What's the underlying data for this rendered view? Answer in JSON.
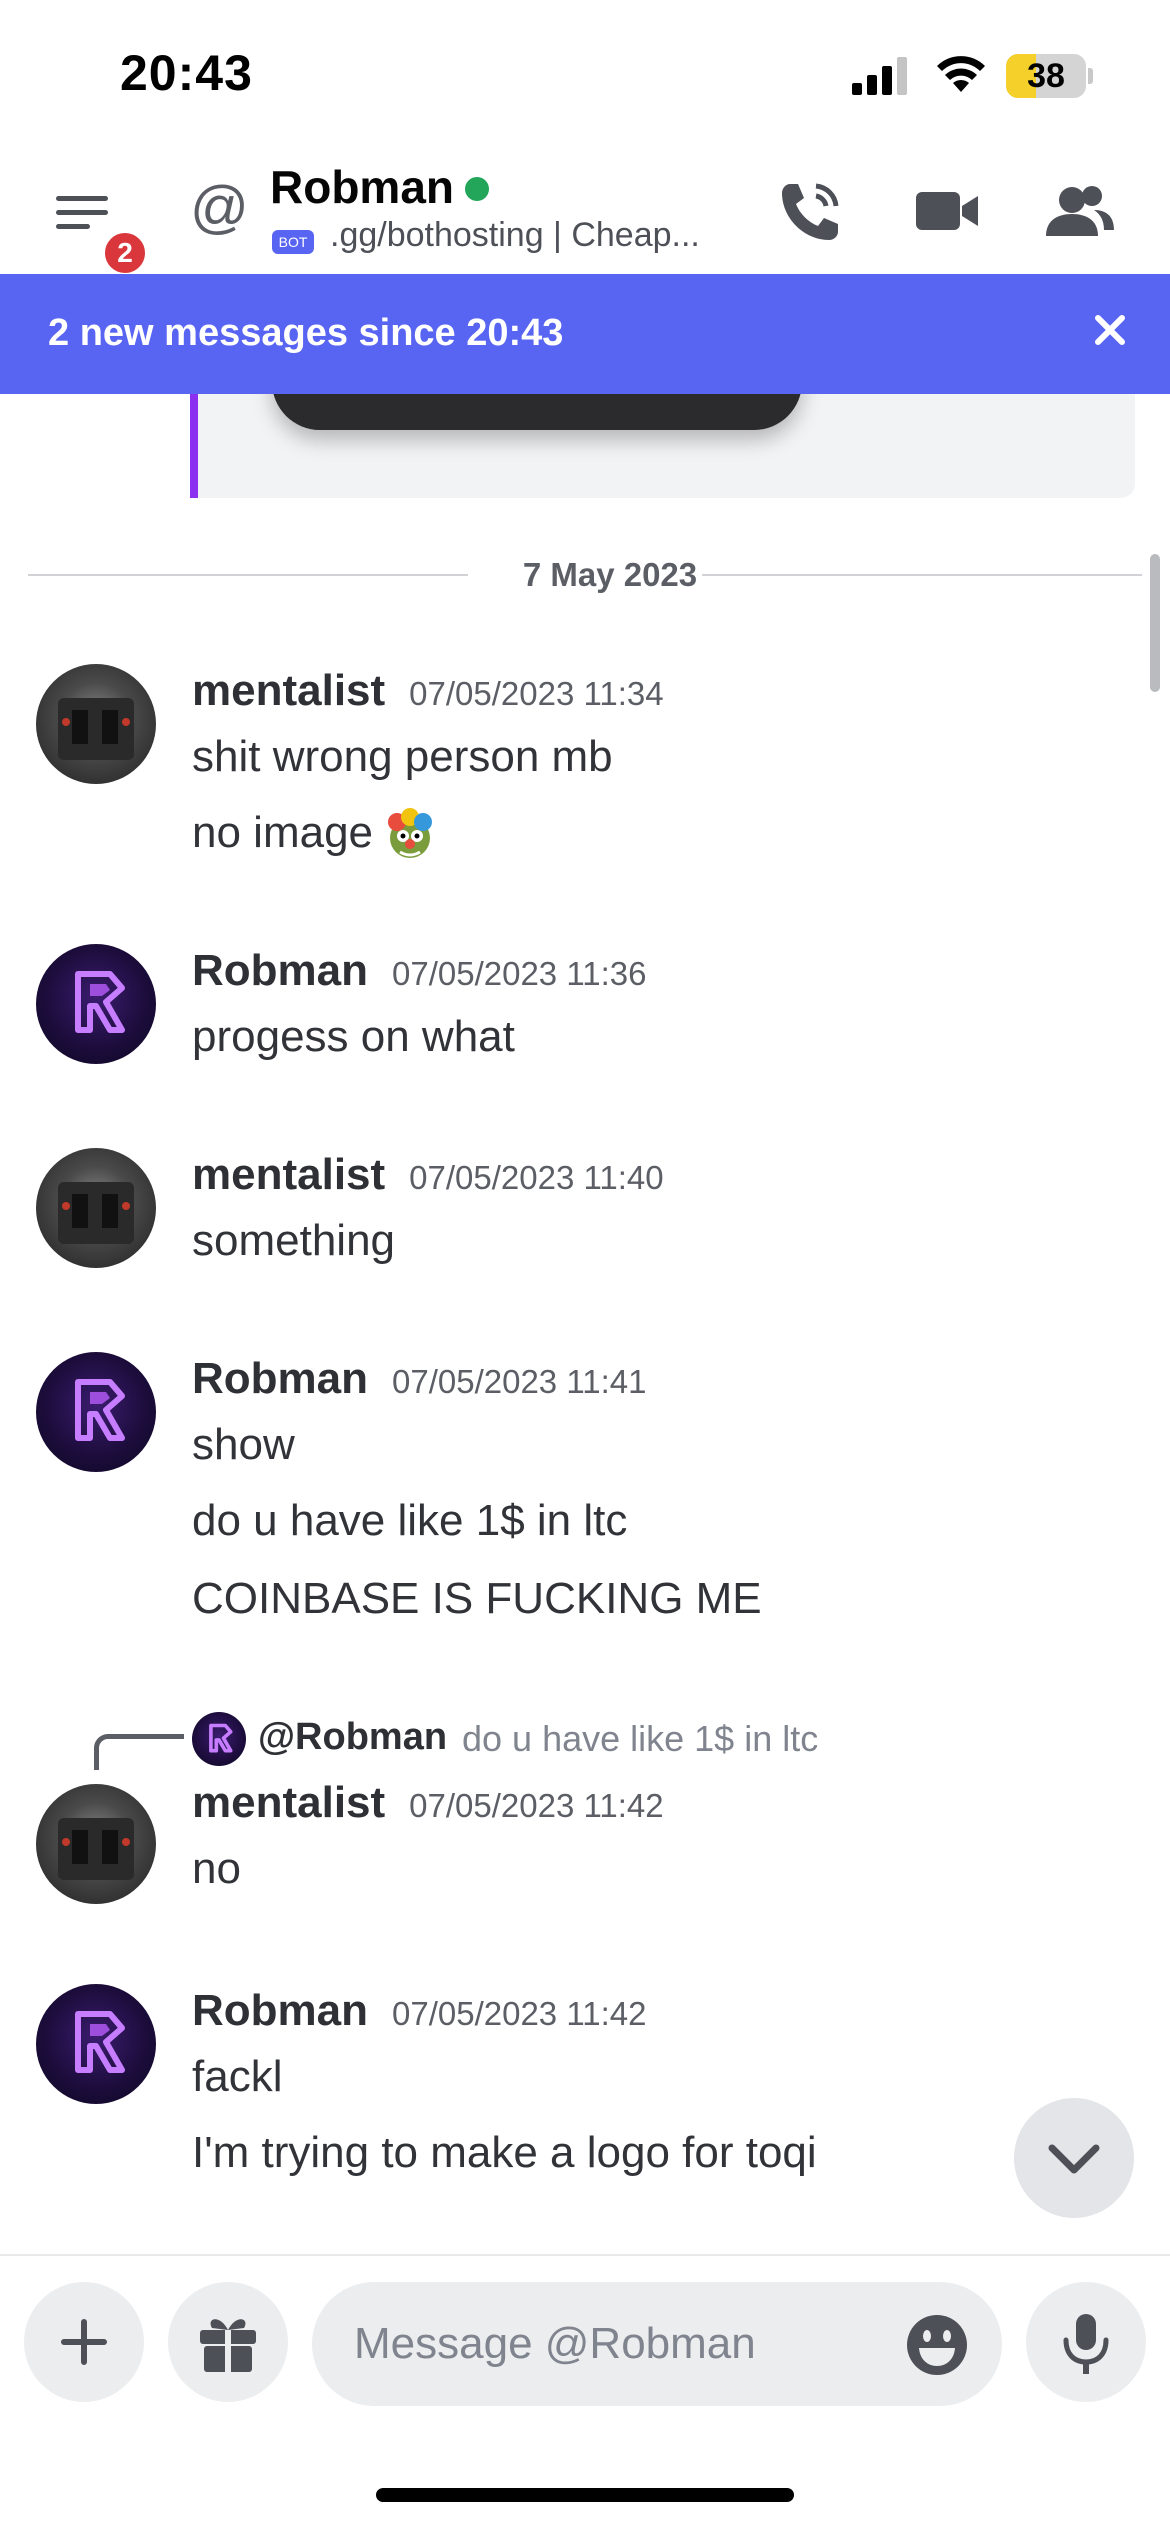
{
  "status_bar": {
    "time": "20:43",
    "battery": "38",
    "battery_level": 0.38
  },
  "header": {
    "menu_badge": "2",
    "at_symbol": "@",
    "channel_name": "Robman",
    "bot_tag": "BOT",
    "subtitle": ".gg/bothosting | Cheap...",
    "icons": [
      "phone-icon",
      "video-camera-icon",
      "members-icon"
    ]
  },
  "new_messages_bar": {
    "text": "2 new messages since 20:43"
  },
  "date_separator": "7 May 2023",
  "messages": [
    {
      "author": "mentalist",
      "timestamp": "07/05/2023 11:34",
      "lines": [
        "shit wrong person mb",
        "no image"
      ]
    },
    {
      "author": "Robman",
      "timestamp": "07/05/2023 11:36",
      "lines": [
        "progess on what"
      ]
    },
    {
      "author": "mentalist",
      "timestamp": "07/05/2023 11:40",
      "lines": [
        "something"
      ]
    },
    {
      "author": "Robman",
      "timestamp": "07/05/2023 11:41",
      "lines": [
        "show",
        "do u have like 1$ in ltc",
        "COINBASE IS FUCKING ME"
      ]
    },
    {
      "author": "mentalist",
      "timestamp": "07/05/2023 11:42",
      "lines": [
        "no"
      ]
    },
    {
      "author": "Robman",
      "timestamp": "07/05/2023 11:42",
      "lines": [
        "fackl",
        "I'm trying to make a logo for toqi"
      ]
    }
  ],
  "reply": {
    "mention": "@Robman",
    "text": "do u have like 1$ in ltc"
  },
  "composer": {
    "placeholder": "Message @Robman"
  },
  "colors": {
    "blurple": "#5865f2",
    "online": "#23a55a",
    "badge": "#da373c",
    "embed_accent": "#8b2ff0"
  }
}
